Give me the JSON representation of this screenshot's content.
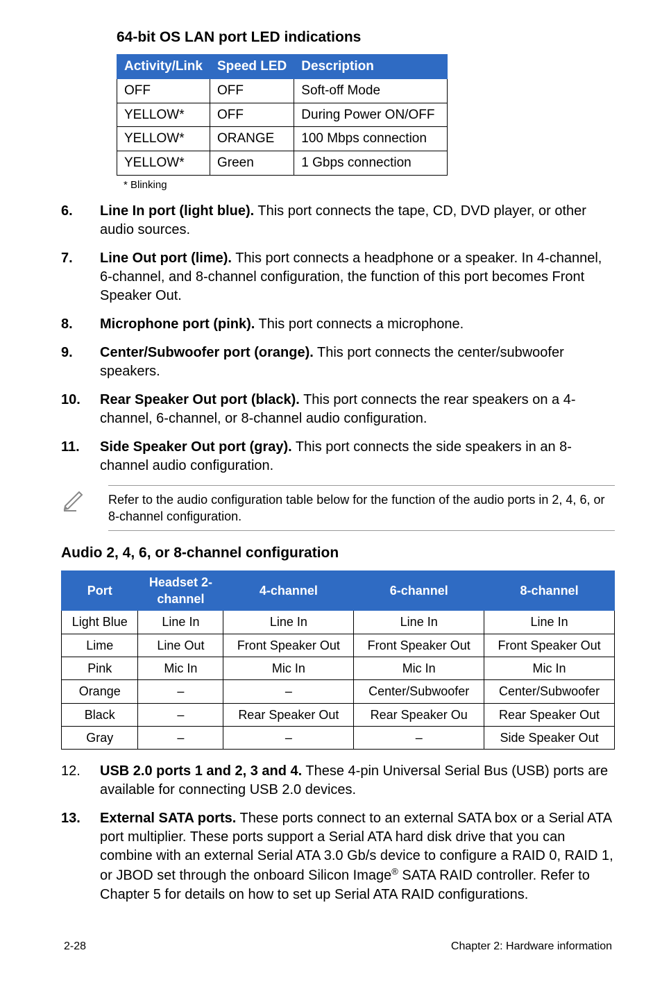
{
  "lan_section_title": "64-bit OS LAN port LED indications",
  "lan_table": {
    "headers": [
      "Activity/Link",
      "Speed LED",
      "Description"
    ],
    "rows": [
      [
        "OFF",
        "OFF",
        "Soft-off Mode"
      ],
      [
        "YELLOW*",
        "OFF",
        "During Power ON/OFF"
      ],
      [
        "YELLOW*",
        "ORANGE",
        "100 Mbps connection"
      ],
      [
        "YELLOW*",
        "Green",
        "1 Gbps connection"
      ]
    ]
  },
  "lan_footnote": "* Blinking",
  "items": [
    {
      "num": "6.",
      "lead": "Line In port (light blue).",
      "rest": " This port connects the tape, CD, DVD player, or other audio sources."
    },
    {
      "num": "7.",
      "lead": "Line Out port (lime).",
      "rest": " This port connects a headphone or a speaker. In 4-channel, 6-channel, and 8-channel configuration, the function of this port becomes Front Speaker Out."
    },
    {
      "num": "8.",
      "lead": "Microphone port (pink).",
      "rest": " This port connects a microphone."
    },
    {
      "num": "9.",
      "lead": "Center/Subwoofer port (orange).",
      "rest": " This port connects the center/subwoofer speakers."
    },
    {
      "num": "10.",
      "lead": "Rear Speaker Out port (black).",
      "rest": " This port connects the rear speakers on a 4-channel, 6-channel, or 8-channel audio configuration."
    },
    {
      "num": "11.",
      "lead": "Side Speaker Out port (gray).",
      "rest": " This port connects the side speakers in an 8-channel audio configuration."
    }
  ],
  "callout_text": "Refer to the audio configuration table below for the function of the audio ports in 2, 4, 6, or 8-channel configuration.",
  "audio_section_title": "Audio 2, 4, 6, or 8-channel configuration",
  "audio_table": {
    "headers": [
      "Port",
      "Headset 2-channel",
      "4-channel",
      "6-channel",
      "8-channel"
    ],
    "rows": [
      [
        "Light Blue",
        "Line In",
        "Line In",
        "Line In",
        "Line In"
      ],
      [
        "Lime",
        "Line Out",
        "Front Speaker Out",
        "Front Speaker Out",
        "Front Speaker Out"
      ],
      [
        "Pink",
        "Mic In",
        "Mic In",
        "Mic In",
        "Mic In"
      ],
      [
        "Orange",
        "–",
        "–",
        "Center/Subwoofer",
        "Center/Subwoofer"
      ],
      [
        "Black",
        "–",
        "Rear Speaker Out",
        "Rear Speaker Ou",
        "Rear Speaker Out"
      ],
      [
        "Gray",
        "–",
        "–",
        "–",
        "Side Speaker Out"
      ]
    ]
  },
  "items2": [
    {
      "num": "12.",
      "lead": "USB 2.0 ports 1 and 2, 3 and 4.",
      "rest": " These 4-pin Universal Serial Bus (USB) ports are available for connecting USB 2.0 devices."
    },
    {
      "num": "13.",
      "lead": "External SATA ports.",
      "rest_pre": " These ports connect to an external SATA box or a Serial ATA port multiplier. These ports support a Serial ATA hard disk drive that you can combine with an external Serial ATA 3.0 Gb/s device to configure a RAID 0, RAID 1, or JBOD set through the onboard Silicon Image",
      "sup": "®",
      "rest_post": " SATA RAID controller. Refer to Chapter 5 for details on how to set up Serial ATA RAID configurations."
    }
  ],
  "footer_left": "2-28",
  "footer_right": "Chapter 2: Hardware information"
}
